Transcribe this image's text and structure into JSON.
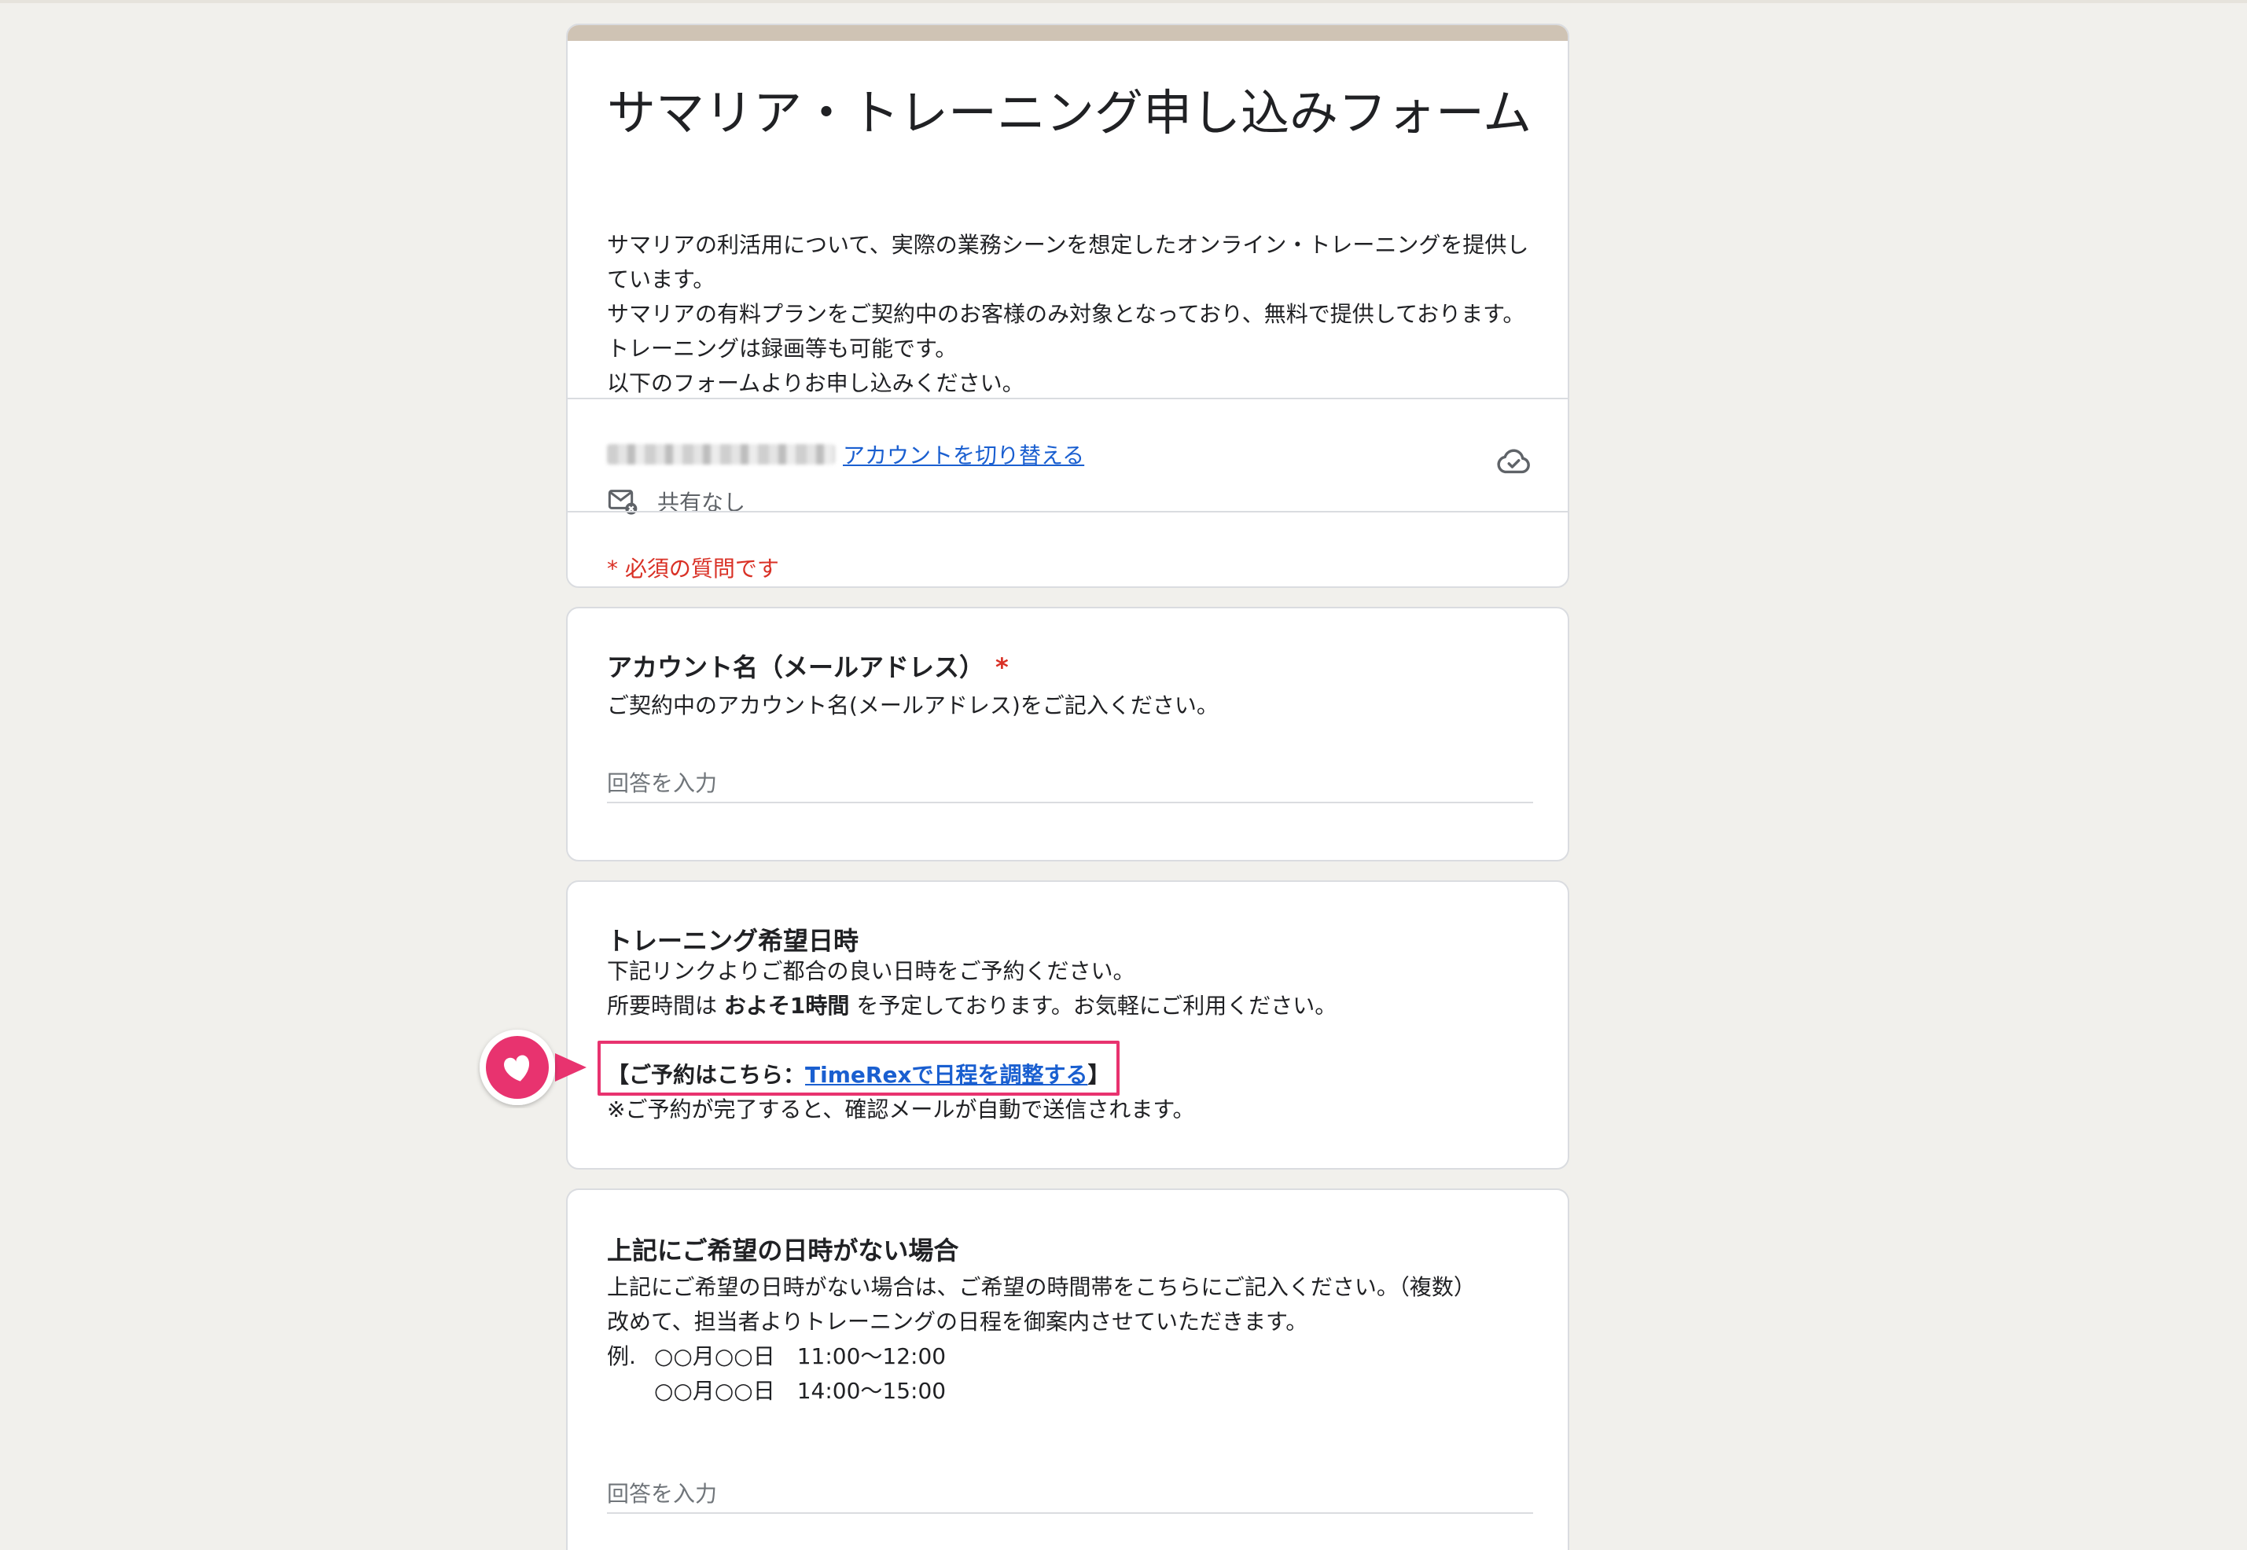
{
  "form": {
    "title": "サマリア・トレーニング申し込みフォーム",
    "description": [
      "サマリアの利活用について、実際の業務シーンを想定したオンライン・トレーニングを提供しています。",
      "サマリアの有料プランをご契約中のお客様のみ対象となっており、無料で提供しております。トレーニングは録画等も可能です。",
      "以下のフォームよりお申し込みください。"
    ],
    "switch_account_label": "アカウントを切り替える",
    "share_status": "共有なし",
    "required_note": "* 必須の質問です"
  },
  "questions": [
    {
      "title": "アカウント名（メールアドレス）",
      "required_mark": "*",
      "description": "ご契約中のアカウント名(メールアドレス)をご記入ください。",
      "placeholder": "回答を入力"
    },
    {
      "title": "トレーニング希望日時",
      "description": [
        "下記リンクよりご都合の良い日時をご予約ください。",
        "所要時間は",
        "およそ1時間",
        "を予定しております。お気軽にご利用ください。"
      ],
      "booking_prefix": "【ご予約はこちら：",
      "booking_link": "TimeRexで日程を調整する",
      "booking_suffix": "】",
      "note": "※ご予約が完了すると、確認メールが自動で送信されます。"
    },
    {
      "title": "上記にご希望の日時がない場合",
      "description": [
        "上記にご希望の日時がない場合は、ご希望の時間帯をこちらにご記入ください。（複数）",
        "改めて、担当者よりトレーニングの日程を御案内させていただきます。"
      ],
      "example_label": "例.",
      "examples": [
        "○○月○○日　11:00〜12:00",
        "○○月○○日　14:00〜15:00"
      ],
      "placeholder": "回答を入力"
    }
  ],
  "colors": {
    "page_background": "#f1f0ec",
    "header_band": "#cfc3b4",
    "link": "#1a5fd0",
    "required": "#d93025",
    "highlight": "#e8336f"
  },
  "icons": {
    "cloud_saved": "cloud-check-icon",
    "mail_not_shared": "mail-off-icon",
    "annotation": "heart-badge-icon"
  }
}
